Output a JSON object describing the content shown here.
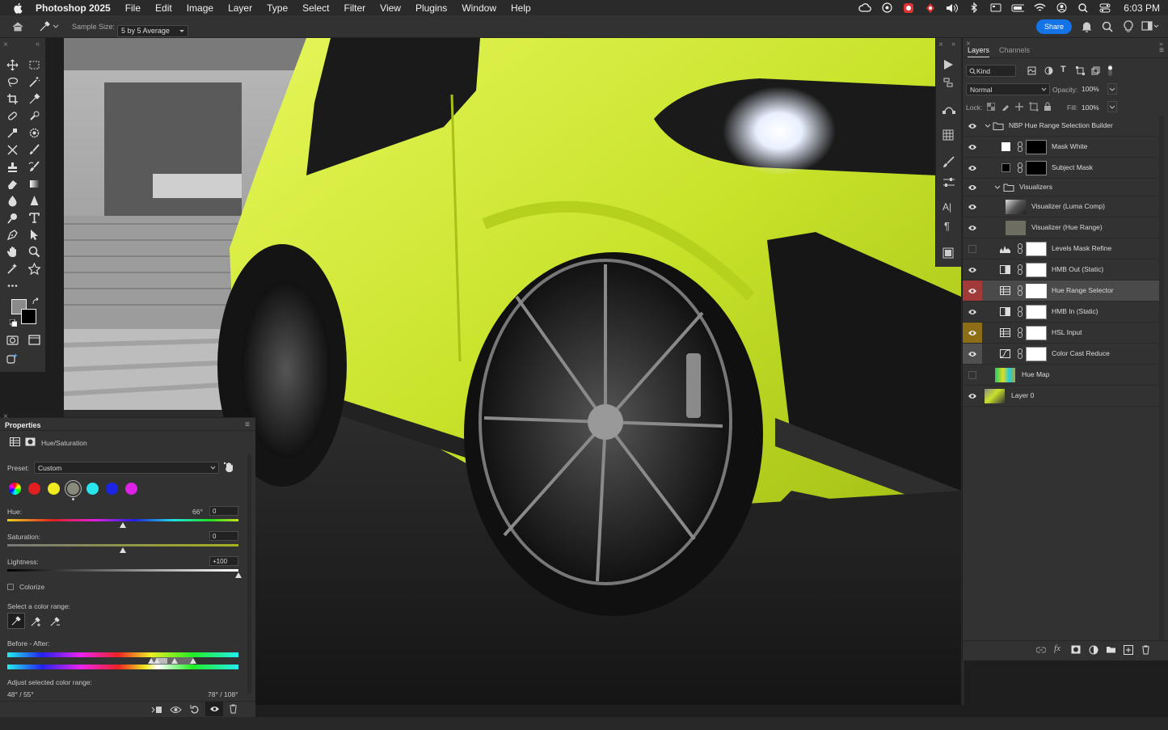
{
  "menubar": {
    "app_name": "Photoshop 2025",
    "menus": [
      "File",
      "Edit",
      "Image",
      "Layer",
      "Type",
      "Select",
      "Filter",
      "View",
      "Plugins",
      "Window",
      "Help"
    ],
    "clock": "6:03 PM"
  },
  "options": {
    "sample_size_label": "Sample Size:",
    "sample_size_value": "5 by 5 Average",
    "share_label": "Share"
  },
  "layers_panel": {
    "tabs": [
      "Layers",
      "Channels"
    ],
    "filter_kind": "Kind",
    "blend_mode": "Normal",
    "opacity_label": "Opacity:",
    "opacity_value": "100%",
    "lock_label": "Lock:",
    "fill_label": "Fill:",
    "fill_value": "100%",
    "layers": [
      {
        "name": "NBP Hue Range Selection Builder",
        "kind": "group"
      },
      {
        "name": "Mask White",
        "kind": "mask-black"
      },
      {
        "name": "Subject Mask",
        "kind": "mask-black"
      },
      {
        "name": "Visualizers",
        "kind": "group"
      },
      {
        "name": "Visualizer (Luma Comp)",
        "kind": "image"
      },
      {
        "name": "Visualizer (Hue Range)",
        "kind": "image"
      },
      {
        "name": "Levels Mask Refine",
        "kind": "levels"
      },
      {
        "name": "HMB Out (Static)",
        "kind": "bw"
      },
      {
        "name": "Hue Range Selector",
        "kind": "huesat"
      },
      {
        "name": "HMB In (Static)",
        "kind": "bw"
      },
      {
        "name": "HSL Input",
        "kind": "huesat"
      },
      {
        "name": "Color Cast Reduce",
        "kind": "curves"
      },
      {
        "name": "Hue Map",
        "kind": "image"
      },
      {
        "name": "Layer 0",
        "kind": "image"
      }
    ]
  },
  "properties": {
    "title": "Properties",
    "adjustment": "Hue/Saturation",
    "preset_label": "Preset:",
    "preset_value": "Custom",
    "hue_label": "Hue:",
    "hue_degrees": "66°",
    "hue_value": "0",
    "saturation_label": "Saturation:",
    "saturation_value": "0",
    "lightness_label": "Lightness:",
    "lightness_value": "+100",
    "colorize_label": "Colorize",
    "select_range_label": "Select a color range:",
    "before_after_label": "Before - After:",
    "adjust_range_label": "Adjust selected color range:",
    "range_left": "48° / 55°",
    "range_right": "78° / 108°",
    "hue_slider": 0.5,
    "saturation_slider": 0.5,
    "lightness_slider": 1.0
  }
}
